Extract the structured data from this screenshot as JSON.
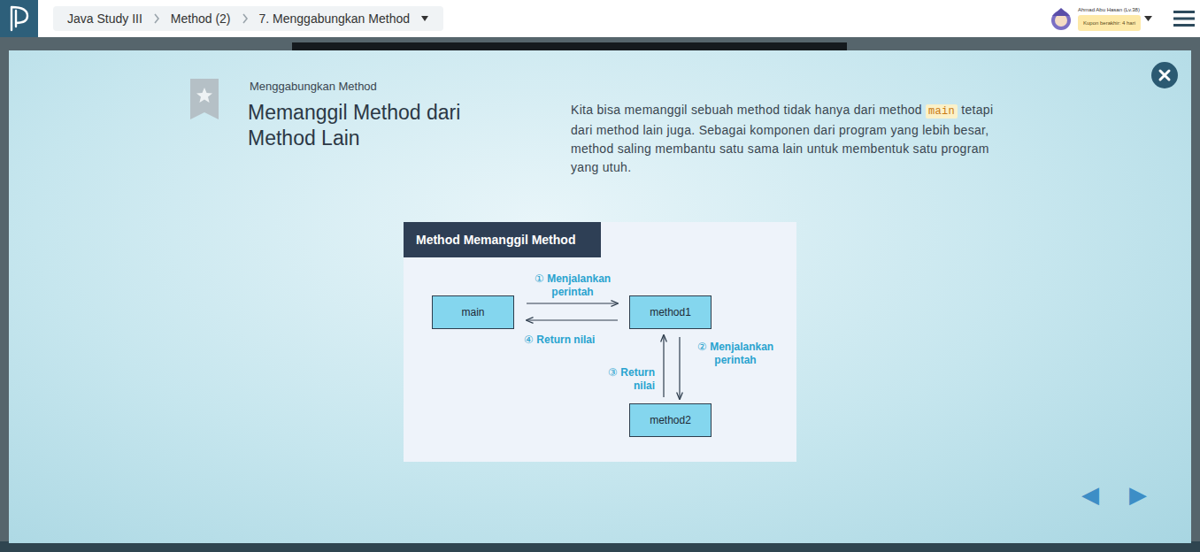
{
  "breadcrumb": [
    {
      "label": "Java Study III"
    },
    {
      "label": "Method (2)"
    },
    {
      "label": "7. Menggabungkan Method"
    }
  ],
  "user": {
    "name": "Ahmad Abu Hasan (Lv.38)",
    "coupon": "Kupon berakhir: 4 hari"
  },
  "slide": {
    "subtitle": "Menggabungkan Method",
    "title": "Memanggil Method dari Method Lain",
    "bookmarked": false,
    "paragraph": {
      "before": "Kita bisa memanggil sebuah method tidak hanya dari method ",
      "code": "main",
      "after": " tetapi dari method lain juga. Sebagai komponen dari program yang lebih besar, method saling membantu satu sama lain untuk membentuk satu program yang utuh."
    }
  },
  "diagram": {
    "title": "Method Memanggil Method",
    "nodes": [
      {
        "label": "main"
      },
      {
        "label": "method1"
      },
      {
        "label": "method2"
      }
    ],
    "steps": [
      {
        "number": "①",
        "label": "Menjalankan perintah"
      },
      {
        "number": "②",
        "label": "Menjalankan perintah"
      },
      {
        "number": "③",
        "label": "Return nilai"
      },
      {
        "number": "④",
        "label": "Return nilai"
      }
    ]
  },
  "nav": {
    "prev": "◀",
    "next": "▶"
  }
}
